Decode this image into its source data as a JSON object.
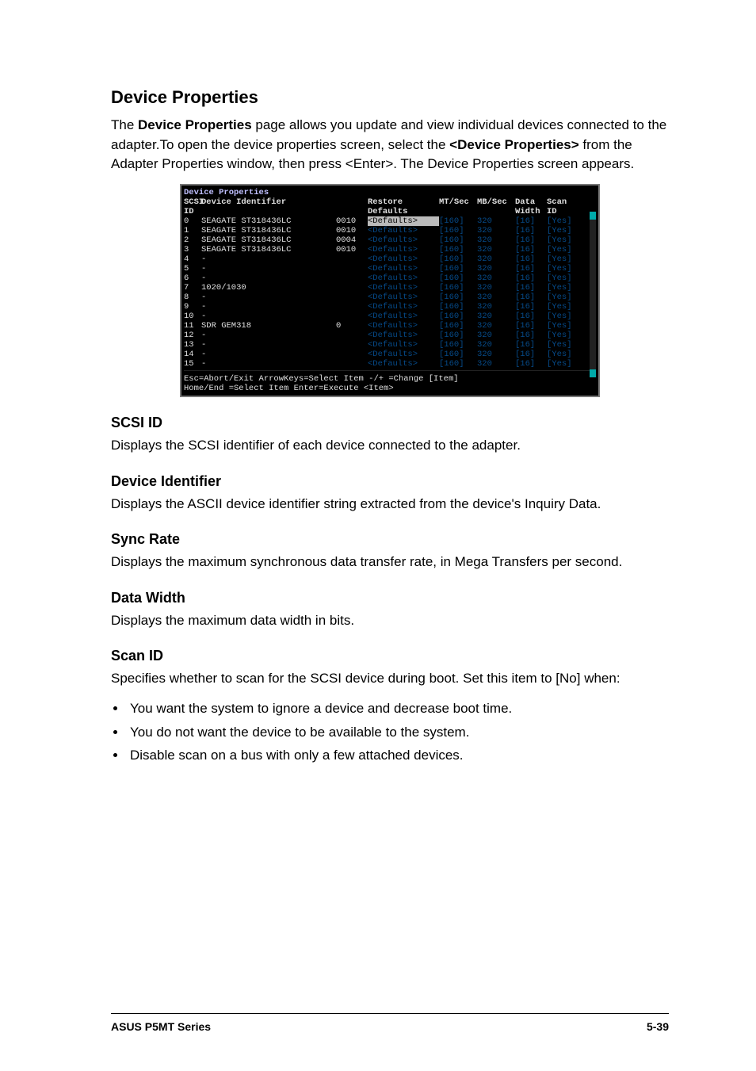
{
  "section": {
    "title": "Device Properties",
    "intro_before_bold1": "The ",
    "bold1": "Device Properties",
    "intro_mid": " page allows you update and view individual devices connected to the adapter.To open the device properties screen, select the ",
    "bold2": "<Device Properties>",
    "intro_after_bold2": " from the Adapter Properties window, then press <Enter>. The Device Properties screen appears."
  },
  "bios": {
    "title": "Device Properties",
    "headers": {
      "scsi_id": "SCSI\nID",
      "dev_id": "Device Identifier",
      "restore": "Restore\nDefaults",
      "mt": "MT/Sec",
      "mb": "MB/Sec",
      "dw": "Data\nWidth",
      "scan": "Scan\nID"
    },
    "rows": [
      {
        "id": "0",
        "dev": "SEAGATE ST318436LC",
        "n": "0010",
        "restore": "<Defaults>",
        "sel": true,
        "mt": "[160]",
        "mb": "320",
        "dw": "[16]",
        "scan": "[Yes]"
      },
      {
        "id": "1",
        "dev": "SEAGATE ST318436LC",
        "n": "0010",
        "restore": "<Defaults>",
        "mt": "[160]",
        "mb": "320",
        "dw": "[16]",
        "scan": "[Yes]"
      },
      {
        "id": "2",
        "dev": "SEAGATE ST318436LC",
        "n": "0004",
        "restore": "<Defaults>",
        "mt": "[160]",
        "mb": "320",
        "dw": "[16]",
        "scan": "[Yes]"
      },
      {
        "id": "3",
        "dev": "SEAGATE ST318436LC",
        "n": "0010",
        "restore": "<Defaults>",
        "mt": "[160]",
        "mb": "320",
        "dw": "[16]",
        "scan": "[Yes]"
      },
      {
        "id": "4",
        "dev": "-",
        "n": "",
        "restore": "<Defaults>",
        "mt": "[160]",
        "mb": "320",
        "dw": "[16]",
        "scan": "[Yes]"
      },
      {
        "id": "5",
        "dev": "-",
        "n": "",
        "restore": "<Defaults>",
        "mt": "[160]",
        "mb": "320",
        "dw": "[16]",
        "scan": "[Yes]"
      },
      {
        "id": "6",
        "dev": "-",
        "n": "",
        "restore": "<Defaults>",
        "mt": "[160]",
        "mb": "320",
        "dw": "[16]",
        "scan": "[Yes]"
      },
      {
        "id": "7",
        "dev": "1020/1030",
        "n": "",
        "restore": "<Defaults>",
        "mt": "[160]",
        "mb": "320",
        "dw": "[16]",
        "scan": "[Yes]"
      },
      {
        "id": "8",
        "dev": "-",
        "n": "",
        "restore": "<Defaults>",
        "mt": "[160]",
        "mb": "320",
        "dw": "[16]",
        "scan": "[Yes]"
      },
      {
        "id": "9",
        "dev": "-",
        "n": "",
        "restore": "<Defaults>",
        "mt": "[160]",
        "mb": "320",
        "dw": "[16]",
        "scan": "[Yes]"
      },
      {
        "id": "10",
        "dev": "-",
        "n": "",
        "restore": "<Defaults>",
        "mt": "[160]",
        "mb": "320",
        "dw": "[16]",
        "scan": "[Yes]"
      },
      {
        "id": "11",
        "dev": "SDR     GEM318",
        "n": "0",
        "restore": "<Defaults>",
        "mt": "[160]",
        "mb": "320",
        "dw": "[16]",
        "scan": "[Yes]"
      },
      {
        "id": "12",
        "dev": "-",
        "n": "",
        "restore": "<Defaults>",
        "mt": "[160]",
        "mb": "320",
        "dw": "[16]",
        "scan": "[Yes]"
      },
      {
        "id": "13",
        "dev": "-",
        "n": "",
        "restore": "<Defaults>",
        "mt": "[160]",
        "mb": "320",
        "dw": "[16]",
        "scan": "[Yes]"
      },
      {
        "id": "14",
        "dev": "-",
        "n": "",
        "restore": "<Defaults>",
        "mt": "[160]",
        "mb": "320",
        "dw": "[16]",
        "scan": "[Yes]"
      },
      {
        "id": "15",
        "dev": "-",
        "n": "",
        "restore": "<Defaults>",
        "mt": "[160]",
        "mb": "320",
        "dw": "[16]",
        "scan": "[Yes]"
      }
    ],
    "footer1": "Esc=Abort/Exit    ArrowKeys=Select Item    -/+  =Change [Item]",
    "footer2": "                  Home/End =Select Item    Enter=Execute <Item>"
  },
  "subs": {
    "scsi_id": {
      "title": "SCSI ID",
      "text": "Displays the SCSI identifier of each device connected to the adapter."
    },
    "device_identifier": {
      "title": "Device Identifier",
      "text": "Displays the ASCII device identifier string extracted from the device's Inquiry Data."
    },
    "sync_rate": {
      "title": "Sync Rate",
      "text": "Displays the maximum synchronous data transfer rate, in Mega Transfers per second."
    },
    "data_width": {
      "title": "Data Width",
      "text": "Displays the maximum data width in bits."
    },
    "scan_id": {
      "title": "Scan ID",
      "text": "Specifies whether to scan for the SCSI device during boot. Set this item to [No] when:",
      "bullets": [
        "You want the system to ignore a device and decrease boot time.",
        "You do not want the device to be available to the system.",
        "Disable scan on a bus with only a few attached devices."
      ]
    }
  },
  "footer": {
    "left": "ASUS P5MT Series",
    "right": "5-39"
  }
}
